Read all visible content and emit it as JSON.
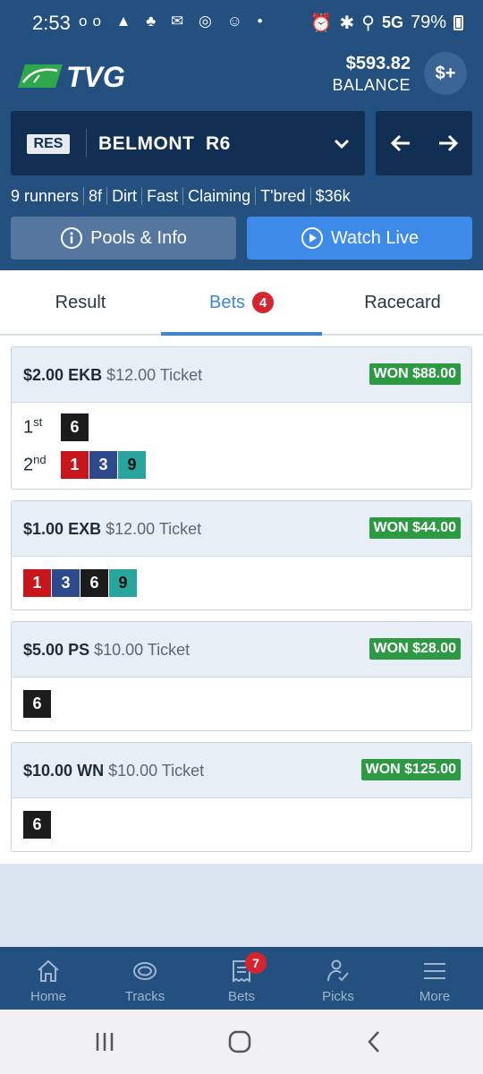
{
  "status_bar": {
    "time": "2:53",
    "left_icons": "oo ▲ ♣ ✉ ◎ ☺  •",
    "network": "5G",
    "battery": "79%"
  },
  "header": {
    "logo_text": "TVG",
    "balance_amount": "$593.82",
    "balance_label": "BALANCE",
    "deposit_label": "$+"
  },
  "race": {
    "status_badge": "RES",
    "track": "BELMONT",
    "race_number": "R6",
    "info": [
      "9 runners",
      "8f",
      "Dirt",
      "Fast",
      "Claiming",
      "T'bred",
      "$36k"
    ]
  },
  "actions": {
    "pools_label": "Pools & Info",
    "watch_label": "Watch Live"
  },
  "tabs": [
    {
      "label": "Result",
      "active": false
    },
    {
      "label": "Bets",
      "active": true,
      "badge": "4"
    },
    {
      "label": "Racecard",
      "active": false
    }
  ],
  "bets": [
    {
      "amount": "$2.00",
      "type": "EKB",
      "ticket": "$12.00 Ticket",
      "result": "WON $88.00",
      "rows": [
        {
          "pos": "1",
          "suffix": "st",
          "runners": [
            "6"
          ]
        },
        {
          "pos": "2",
          "suffix": "nd",
          "runners": [
            "1",
            "3",
            "9"
          ]
        }
      ]
    },
    {
      "amount": "$1.00",
      "type": "EXB",
      "ticket": "$12.00 Ticket",
      "result": "WON $44.00",
      "rows": [
        {
          "pos": "",
          "suffix": "",
          "runners": [
            "1",
            "3",
            "6",
            "9"
          ]
        }
      ]
    },
    {
      "amount": "$5.00",
      "type": "PS",
      "ticket": "$10.00 Ticket",
      "result": "WON $28.00",
      "rows": [
        {
          "pos": "",
          "suffix": "",
          "runners": [
            "6"
          ]
        }
      ]
    },
    {
      "amount": "$10.00",
      "type": "WN",
      "ticket": "$10.00 Ticket",
      "result": "WON $125.00",
      "rows": [
        {
          "pos": "",
          "suffix": "",
          "runners": [
            "6"
          ]
        }
      ]
    }
  ],
  "runner_colors": {
    "1": "#c8161d",
    "3": "#2e4a8c",
    "6": "#1c1c1c",
    "9": "#2aa59e"
  },
  "bottom_nav": [
    {
      "label": "Home",
      "icon": "home-icon"
    },
    {
      "label": "Tracks",
      "icon": "tracks-icon"
    },
    {
      "label": "Bets",
      "icon": "bets-icon",
      "badge": "7"
    },
    {
      "label": "Picks",
      "icon": "picks-icon"
    },
    {
      "label": "More",
      "icon": "menu-icon"
    }
  ],
  "colors": {
    "header_bg": "#23507f",
    "race_selector_bg": "#102f52",
    "accent_blue": "#3c86d9",
    "won_green": "#2d9943",
    "badge_red": "#d6252e"
  }
}
